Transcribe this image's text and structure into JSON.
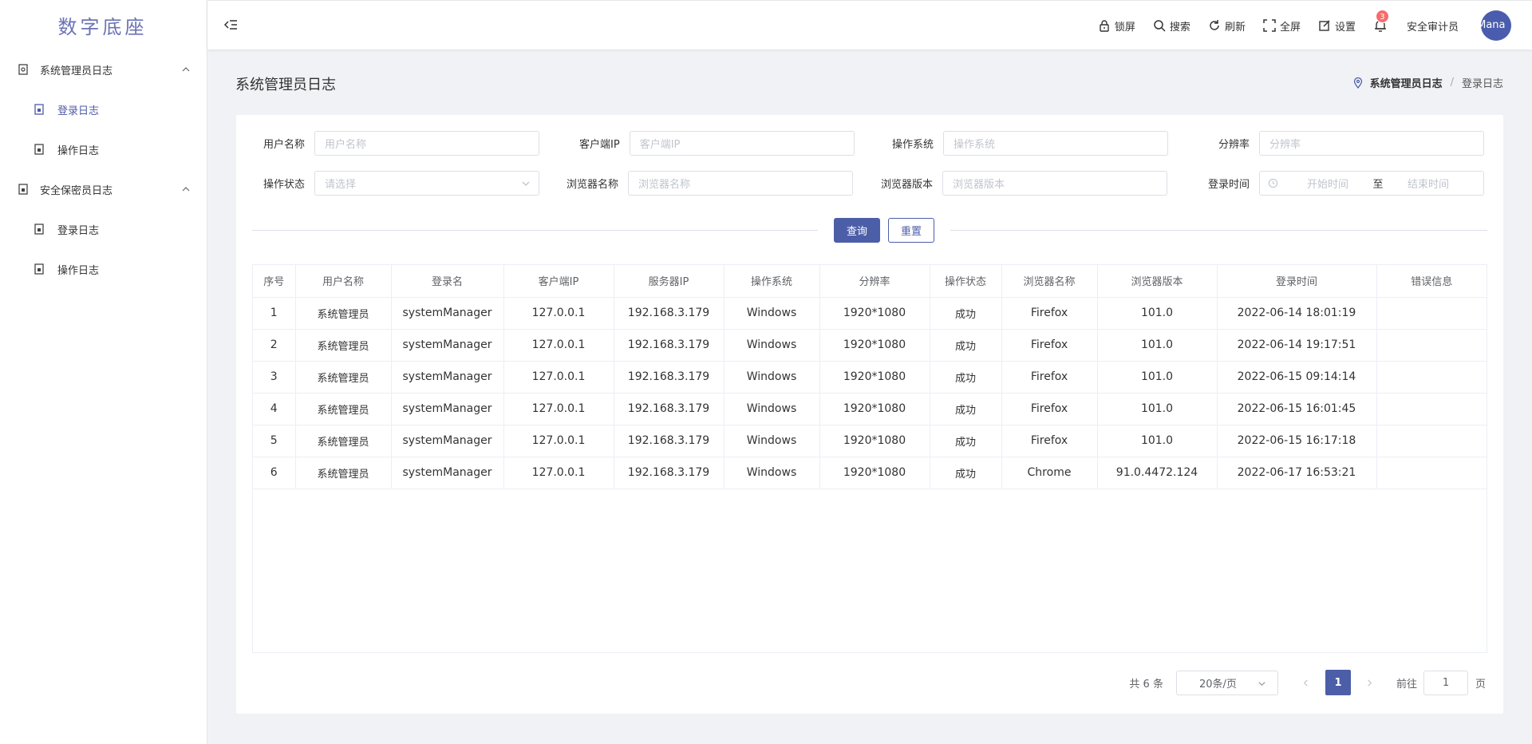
{
  "app": {
    "logo": "数字底座"
  },
  "sidebar": {
    "groups": [
      {
        "label": "系统管理员日志",
        "items": [
          {
            "label": "登录日志",
            "active": true
          },
          {
            "label": "操作日志",
            "active": false
          }
        ]
      },
      {
        "label": "安全保密员日志",
        "items": [
          {
            "label": "登录日志",
            "active": false
          },
          {
            "label": "操作日志",
            "active": false
          }
        ]
      }
    ]
  },
  "header": {
    "tools": {
      "lock": "锁屏",
      "search": "搜索",
      "refresh": "刷新",
      "fullscreen": "全屏",
      "settings": "设置"
    },
    "notification_count": "3",
    "username": "安全审计员",
    "avatar_text": "tMana"
  },
  "page": {
    "title": "系统管理员日志",
    "breadcrumb": [
      "系统管理员日志",
      "登录日志"
    ]
  },
  "filters": {
    "username": {
      "label": "用户名称",
      "placeholder": "用户名称"
    },
    "client_ip": {
      "label": "客户端IP",
      "placeholder": "客户端IP"
    },
    "os": {
      "label": "操作系统",
      "placeholder": "操作系统"
    },
    "resolution": {
      "label": "分辨率",
      "placeholder": "分辨率"
    },
    "status": {
      "label": "操作状态",
      "placeholder": "请选择"
    },
    "browser": {
      "label": "浏览器名称",
      "placeholder": "浏览器名称"
    },
    "browser_version": {
      "label": "浏览器版本",
      "placeholder": "浏览器版本"
    },
    "login_time": {
      "label": "登录时间",
      "start_placeholder": "开始时间",
      "separator": "至",
      "end_placeholder": "结束时间"
    }
  },
  "actions": {
    "query": "查询",
    "reset": "重置"
  },
  "table": {
    "columns": [
      "序号",
      "用户名称",
      "登录名",
      "客户端IP",
      "服务器IP",
      "操作系统",
      "分辨率",
      "操作状态",
      "浏览器名称",
      "浏览器版本",
      "登录时间",
      "错误信息"
    ],
    "rows": [
      [
        "1",
        "系统管理员",
        "systemManager",
        "127.0.0.1",
        "192.168.3.179",
        "Windows",
        "1920*1080",
        "成功",
        "Firefox",
        "101.0",
        "2022-06-14 18:01:19",
        ""
      ],
      [
        "2",
        "系统管理员",
        "systemManager",
        "127.0.0.1",
        "192.168.3.179",
        "Windows",
        "1920*1080",
        "成功",
        "Firefox",
        "101.0",
        "2022-06-14 19:17:51",
        ""
      ],
      [
        "3",
        "系统管理员",
        "systemManager",
        "127.0.0.1",
        "192.168.3.179",
        "Windows",
        "1920*1080",
        "成功",
        "Firefox",
        "101.0",
        "2022-06-15 09:14:14",
        ""
      ],
      [
        "4",
        "系统管理员",
        "systemManager",
        "127.0.0.1",
        "192.168.3.179",
        "Windows",
        "1920*1080",
        "成功",
        "Firefox",
        "101.0",
        "2022-06-15 16:01:45",
        ""
      ],
      [
        "5",
        "系统管理员",
        "systemManager",
        "127.0.0.1",
        "192.168.3.179",
        "Windows",
        "1920*1080",
        "成功",
        "Firefox",
        "101.0",
        "2022-06-15 16:17:18",
        ""
      ],
      [
        "6",
        "系统管理员",
        "systemManager",
        "127.0.0.1",
        "192.168.3.179",
        "Windows",
        "1920*1080",
        "成功",
        "Chrome",
        "91.0.4472.124",
        "2022-06-17 16:53:21",
        ""
      ]
    ]
  },
  "pagination": {
    "total": "共 6 条",
    "page_size": "20条/页",
    "current_page": "1",
    "goto_label": "前往",
    "goto_value": "1",
    "goto_suffix": "页"
  },
  "colors": {
    "primary": "#4d5ea8",
    "badge": "#f56c6c",
    "active_menu": "#4f5ba6"
  }
}
